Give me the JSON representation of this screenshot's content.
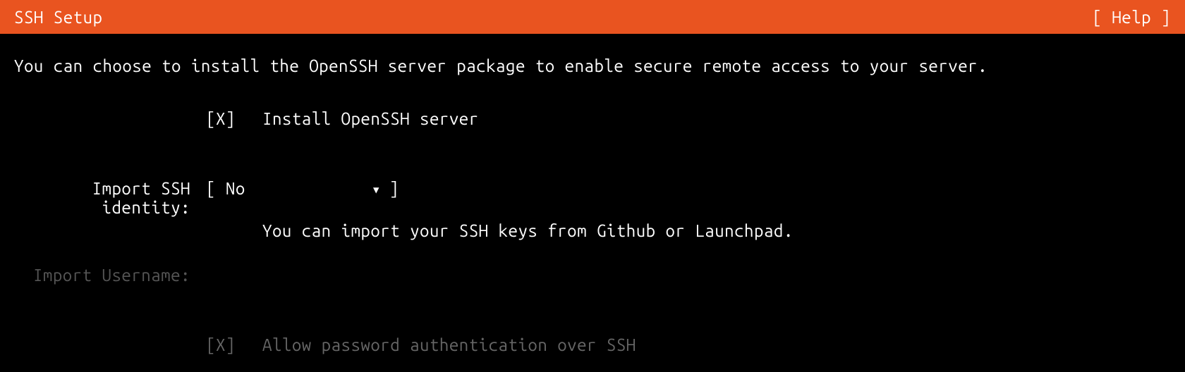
{
  "header": {
    "title": "SSH Setup",
    "help": "[ Help ]"
  },
  "description": "You can choose to install the OpenSSH server package to enable secure remote access to your server.",
  "install": {
    "checkbox": "[X]",
    "label": "Install OpenSSH server"
  },
  "import": {
    "label": "Import SSH identity:",
    "bracket_open": "[ ",
    "value": "No",
    "bracket_close": " ]",
    "help": "You can import your SSH keys from Github or Launchpad."
  },
  "username": {
    "label": "Import Username:"
  },
  "allow_password": {
    "checkbox": "[X]",
    "label": "Allow password authentication over SSH"
  }
}
